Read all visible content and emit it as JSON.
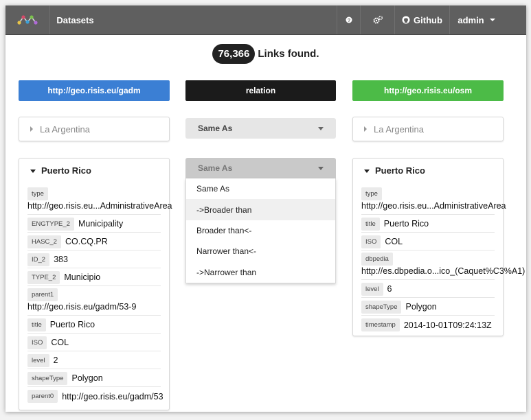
{
  "navbar": {
    "brand": "Datasets",
    "help_icon": "question-icon",
    "settings_icon": "gears-icon",
    "github_label": "Github",
    "user_label": "admin"
  },
  "summary": {
    "count": "76,366",
    "text": "Links found."
  },
  "headers": {
    "source": "http://geo.risis.eu/gadm",
    "relation": "relation",
    "target": "http://geo.risis.eu/osm"
  },
  "search": {
    "source_value": "La Argentina",
    "target_value": "La Argentina"
  },
  "relation_select": {
    "top_value": "Same As",
    "open_value": "Same As",
    "options": [
      "Same As",
      "->Broader than",
      "Broader than<-",
      "Narrower than<-",
      "->Narrower than"
    ]
  },
  "source_card": {
    "title": "Puerto Rico",
    "props": [
      {
        "label": "type",
        "value": "http://geo.risis.eu...AdministrativeArea"
      },
      {
        "label": "ENGTYPE_2",
        "value": "Municipality"
      },
      {
        "label": "HASC_2",
        "value": "CO.CQ.PR"
      },
      {
        "label": "ID_2",
        "value": "383"
      },
      {
        "label": "TYPE_2",
        "value": "Municipio"
      },
      {
        "label": "parent1",
        "value": "http://geo.risis.eu/gadm/53-9"
      },
      {
        "label": "title",
        "value": "Puerto Rico"
      },
      {
        "label": "ISO",
        "value": "COL"
      },
      {
        "label": "level",
        "value": "2"
      },
      {
        "label": "shapeType",
        "value": "Polygon"
      },
      {
        "label": "parent0",
        "value": "http://geo.risis.eu/gadm/53"
      }
    ]
  },
  "target_card": {
    "title": "Puerto Rico",
    "props": [
      {
        "label": "type",
        "value": "http://geo.risis.eu...AdministrativeArea"
      },
      {
        "label": "title",
        "value": "Puerto Rico"
      },
      {
        "label": "ISO",
        "value": "COL"
      },
      {
        "label": "dbpedia",
        "value": "http://es.dbpedia.o...ico_(Caquet%C3%A1)"
      },
      {
        "label": "level",
        "value": "6"
      },
      {
        "label": "shapeType",
        "value": "Polygon"
      },
      {
        "label": "timestamp",
        "value": "2014-10-01T09:24:13Z"
      }
    ]
  },
  "colors": {
    "source_accent": "#3b7fd4",
    "relation_accent": "#1b1b1b",
    "target_accent": "#4cbb47",
    "navbar": "#5f5f5f"
  }
}
